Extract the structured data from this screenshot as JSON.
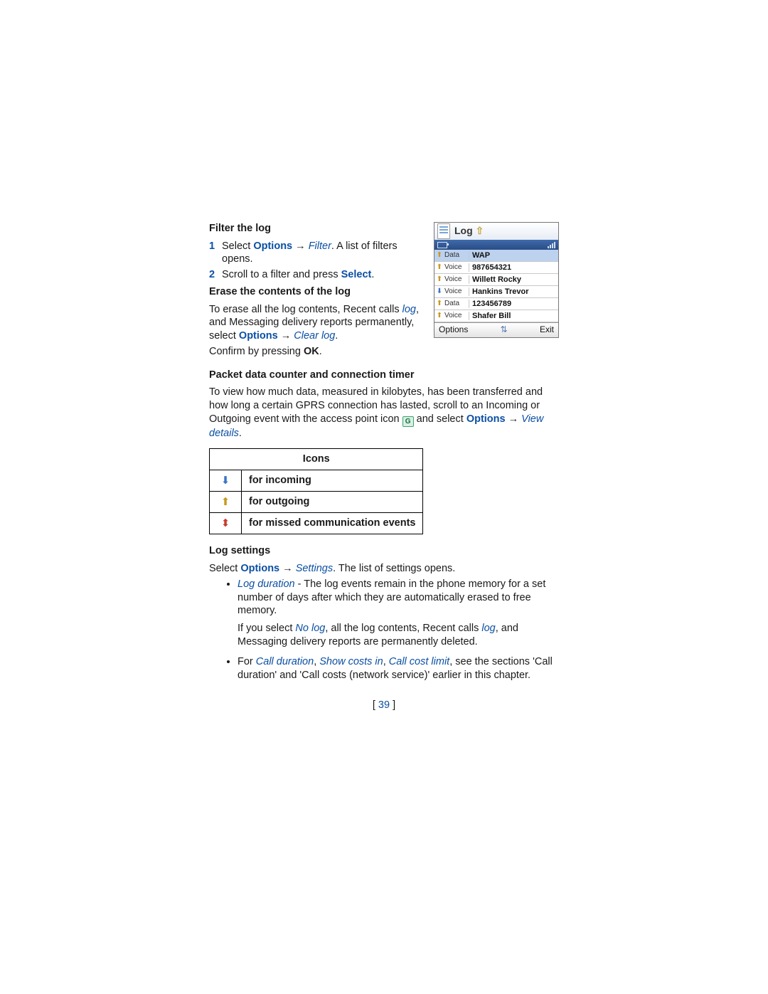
{
  "headings": {
    "filter": "Filter the log",
    "erase": "Erase the contents of the log",
    "packet": "Packet data counter and connection timer",
    "logSettings": "Log settings"
  },
  "labels": {
    "options": "Options",
    "select": "Select",
    "ok": "OK",
    "log": "log"
  },
  "italic": {
    "filter": "Filter",
    "clearLog": "Clear log",
    "viewDetails": "View details",
    "settings": "Settings",
    "logDuration": "Log duration",
    "noLog": "No log",
    "callDuration": "Call duration",
    "showCostsIn": "Show costs in",
    "callCostLimit": "Call cost limit"
  },
  "steps": {
    "one": "1",
    "oneTextA": "Select ",
    "oneArrow": " → ",
    "oneTextB": ". A list of filters opens.",
    "two": "2",
    "twoTextA": "Scroll to a filter and press ",
    "twoTextB": "."
  },
  "erase": {
    "textA": "To erase all the log contents, Recent calls ",
    "textB": ", and Messaging delivery reports permanently, select ",
    "arrow": " → ",
    "textC": ".",
    "confirmA": "Confirm by pressing ",
    "confirmB": "."
  },
  "packet": {
    "textA": "To view how much data, measured in kilobytes, has been transferred and how long a certain GPRS connection has lasted, scroll to an Incoming or Outgoing event with the access point icon ",
    "textB": " and select ",
    "arrow": " → ",
    "textC": "."
  },
  "iconsTable": {
    "header": "Icons",
    "rows": [
      {
        "label": "for incoming"
      },
      {
        "label": "for outgoing"
      },
      {
        "label": "for missed communication events"
      }
    ]
  },
  "bullets": {
    "b1a": " - The log events remain in the phone memory for a set number of days after which they are automatically erased to free memory.",
    "b1b_a": "If you select ",
    "b1b_b": ", all the log contents, Recent calls ",
    "b1b_c": ", and Messaging delivery reports are permanently deleted.",
    "b2a": "For ",
    "b2sep1": ", ",
    "b2sep2": ", ",
    "b2b": ", see the sections 'Call duration' and 'Call costs (network service)' earlier in this chapter."
  },
  "logSettings": {
    "textA": "Select ",
    "arrow": " → ",
    "textB": ". The list of settings opens."
  },
  "phone": {
    "title": "Log",
    "rows": [
      {
        "dir": "out",
        "kind": "Data",
        "value": "WAP",
        "sel": true
      },
      {
        "dir": "out",
        "kind": "Voice",
        "value": "987654321"
      },
      {
        "dir": "out",
        "kind": "Voice",
        "value": "Willett Rocky"
      },
      {
        "dir": "in",
        "kind": "Voice",
        "value": "Hankins Trevor"
      },
      {
        "dir": "out",
        "kind": "Data",
        "value": "123456789"
      },
      {
        "dir": "out",
        "kind": "Voice",
        "value": "Shafer Bill"
      }
    ],
    "softLeft": "Options",
    "softMid": "⇅",
    "softRight": "Exit"
  },
  "pageNumber": "39"
}
